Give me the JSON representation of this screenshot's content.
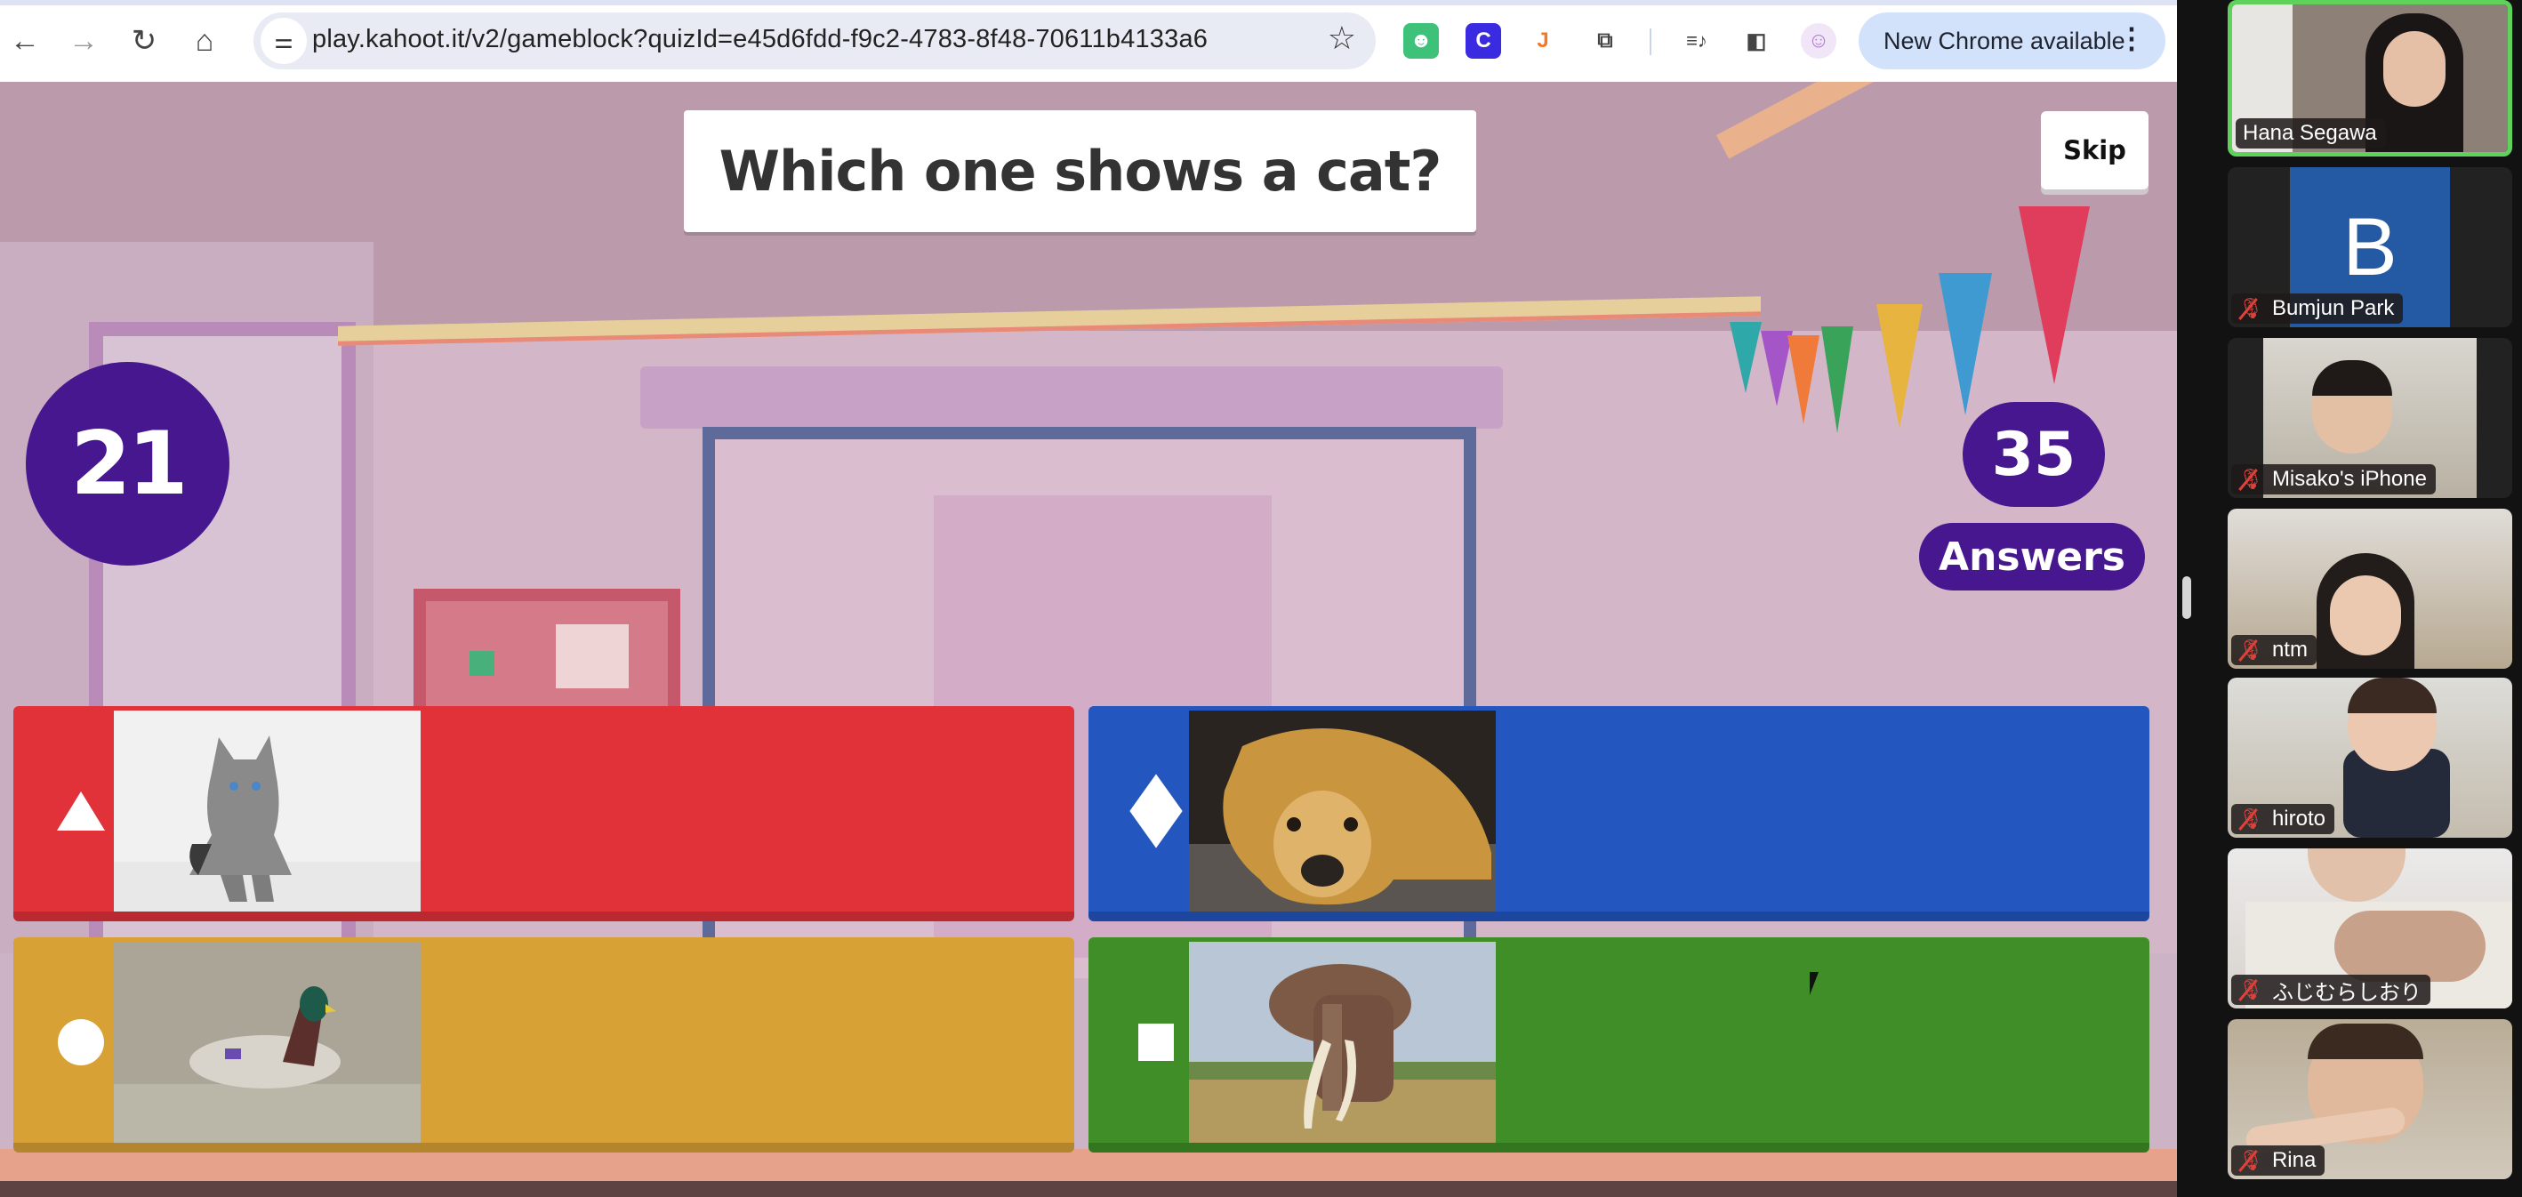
{
  "browser": {
    "url": "play.kahoot.it/v2/gameblock?quizId=e45d6fdd-f9c2-4783-8f48-70611b4133a6",
    "update_label": "New Chrome available",
    "extensions": [
      {
        "name": "grammarly-like-extension",
        "glyph": "☻",
        "color": "#3ec27a"
      },
      {
        "name": "canva-extension",
        "glyph": "C",
        "color": "#3b2be0"
      },
      {
        "name": "hook-extension",
        "glyph": "J",
        "color": "#f07a2a"
      },
      {
        "name": "extensions-puzzle",
        "glyph": "⧉",
        "color": "#444444"
      },
      {
        "name": "media-controls",
        "glyph": "≡♪",
        "color": "#444444"
      },
      {
        "name": "side-panel",
        "glyph": "◧",
        "color": "#444444"
      },
      {
        "name": "profile-avatar",
        "glyph": "☺",
        "color": "#b07ad0"
      }
    ]
  },
  "game": {
    "question": "Which one shows a cat?",
    "skip_label": "Skip",
    "timer": "21",
    "answer_count": "35",
    "answers_label": "Answers",
    "colors": {
      "red": "#e1323a",
      "blue": "#2356be",
      "yellow": "#d8a135",
      "green": "#3f8e27",
      "purple": "#46178f"
    },
    "answers": [
      {
        "shape": "triangle",
        "image": "cat",
        "color": "red"
      },
      {
        "shape": "diamond",
        "image": "dog",
        "color": "blue"
      },
      {
        "shape": "circle",
        "image": "duck",
        "color": "yellow"
      },
      {
        "shape": "square",
        "image": "elephant",
        "color": "green"
      }
    ]
  },
  "participants": [
    {
      "name": "Hana Segawa",
      "muted": false,
      "speaking": true
    },
    {
      "name": "Bumjun Park",
      "muted": true,
      "avatar_letter": "B"
    },
    {
      "name": "Misako's iPhone",
      "muted": true
    },
    {
      "name": "ntm",
      "muted": true
    },
    {
      "name": "hiroto",
      "muted": true
    },
    {
      "name": "ふじむらしおり",
      "muted": true
    },
    {
      "name": "Rina",
      "muted": true
    }
  ]
}
